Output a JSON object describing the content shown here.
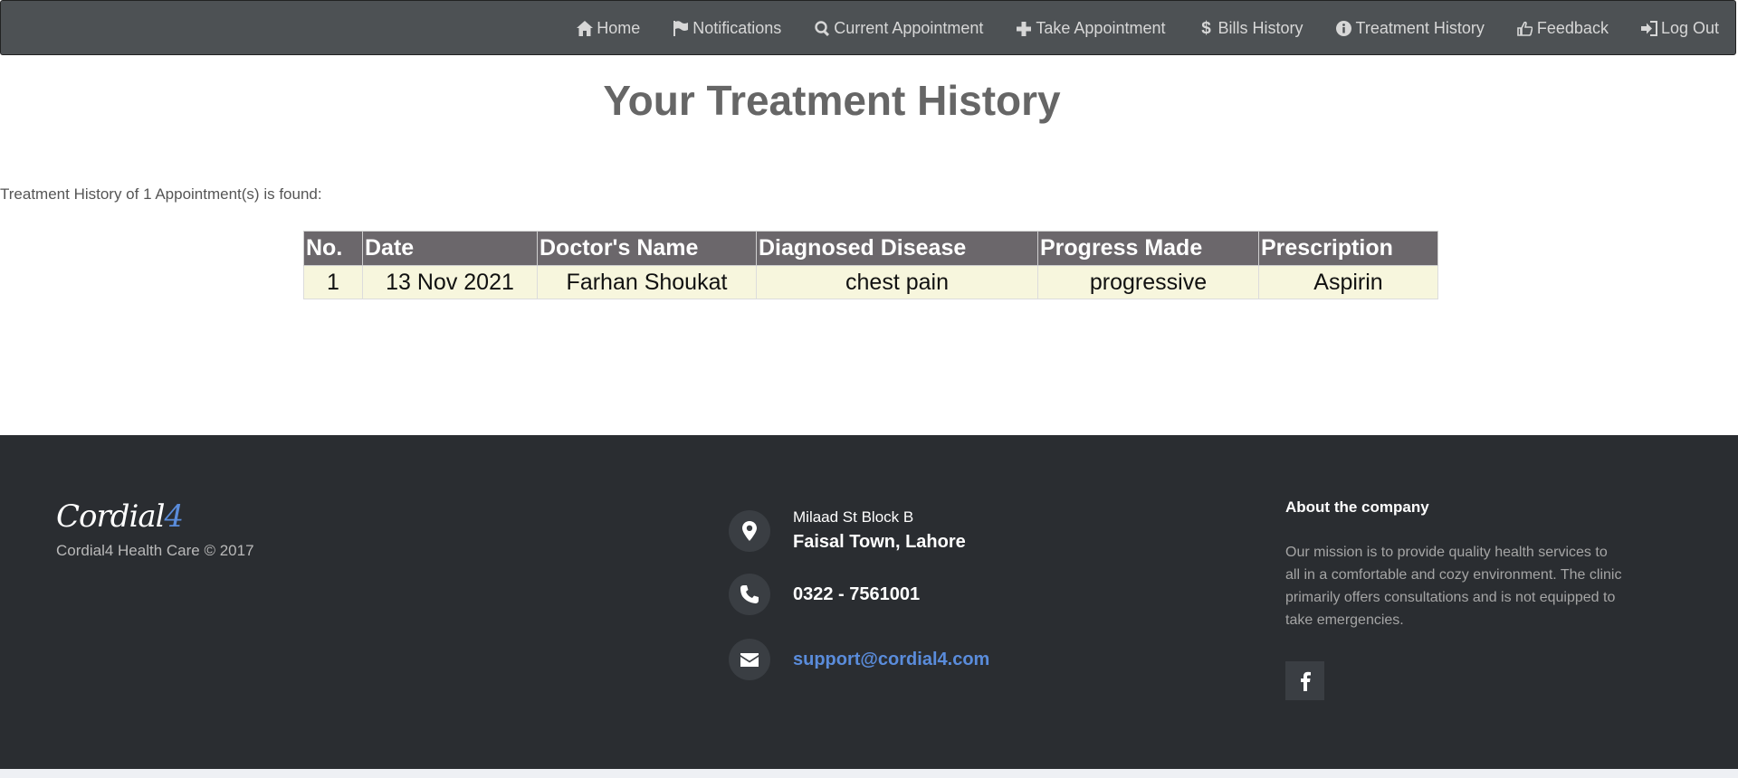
{
  "nav": {
    "items": [
      {
        "label": "Home",
        "icon": "home-icon"
      },
      {
        "label": "Notifications",
        "icon": "flag-icon"
      },
      {
        "label": "Current Appointment",
        "icon": "search-icon"
      },
      {
        "label": "Take Appointment",
        "icon": "plus-icon"
      },
      {
        "label": "Bills History",
        "icon": "dollar-icon"
      },
      {
        "label": "Treatment History",
        "icon": "info-icon"
      },
      {
        "label": "Feedback",
        "icon": "thumbs-up-icon"
      },
      {
        "label": "Log Out",
        "icon": "logout-icon"
      }
    ]
  },
  "page": {
    "title": "Your Treatment History",
    "summary": "Treatment History of 1 Appointment(s) is found:"
  },
  "table": {
    "headers": [
      "No.",
      "Date",
      "Doctor's Name",
      "Diagnosed Disease",
      "Progress Made",
      "Prescription"
    ],
    "rows": [
      [
        "1",
        "13 Nov 2021",
        "Farhan Shoukat",
        "chest pain",
        "progressive",
        "Aspirin"
      ]
    ]
  },
  "footer": {
    "logo_main": "Cordial",
    "logo_accent": "4",
    "copyright": "Cordial4 Health Care © 2017",
    "address_line1": "Milaad St Block B",
    "address_line2": "Faisal Town, Lahore",
    "phone": "0322 - 7561001",
    "email": "support@cordial4.com",
    "about_title": "About the company",
    "about_text": "Our mission is to provide quality health services to all in a comfortable and cozy environment. The clinic primarily offers consultations and is not equipped to take emergencies.",
    "social_icon": "facebook-icon"
  },
  "colors": {
    "navbar": "#4d5154",
    "footer": "#2a2d31",
    "table_header": "#6b676b",
    "table_row": "#f7f6dd",
    "accent": "#5a8cdb"
  }
}
